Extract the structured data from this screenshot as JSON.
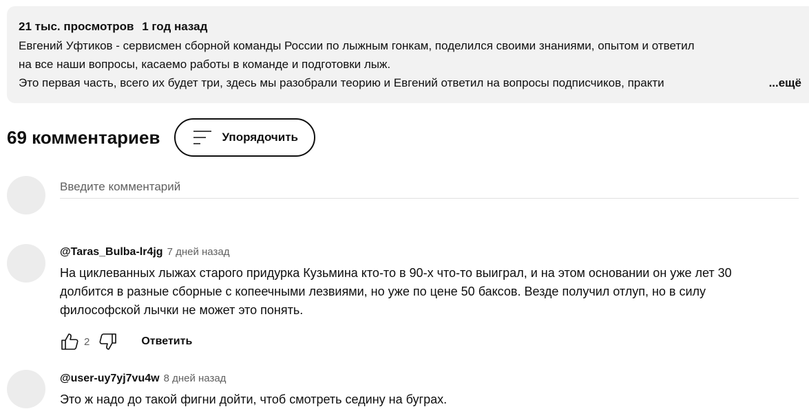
{
  "description": {
    "views": "21 тыс. просмотров",
    "date": "1 год назад",
    "line1": "Евгений Уфтиков - сервисмен сборной команды России по лыжным гонкам, поделился своими знаниями, опытом и ответил",
    "line2": "на все наши вопросы,  касаемо работы в команде и подготовки лыж.",
    "line3": "Это первая часть, всего их будет три, здесь мы разобрали теорию и Евгений ответил на вопросы подписчиков, практи",
    "more_label": "...ещё"
  },
  "comments_header": {
    "count_label": "69 комментариев",
    "sort_label": "Упорядочить",
    "sort_icon": "sort-icon"
  },
  "new_comment": {
    "placeholder": "Введите комментарий"
  },
  "comments": [
    {
      "author": "@Taras_Bulba-lr4jg",
      "time": "7 дней назад",
      "lines": [
        "На циклеванных лыжах старого придурка Кузьмина кто-то в 90-х что-то выиграл, и на этом основании он уже лет 30",
        "долбится в разные сборные с копеечными лезвиями, но уже по цене 50 баксов. Везде получил отлуп, но в силу",
        "философской лычки не может это понять."
      ],
      "likes": "2",
      "reply_label": "Ответить",
      "like_icon": "thumbs-up-icon",
      "dislike_icon": "thumbs-down-icon"
    },
    {
      "author": "@user-uy7yj7vu4w",
      "time": "8 дней назад",
      "lines": [
        "Это ж надо до такой фигни дойти, чтоб смотреть седину на буграх."
      ]
    }
  ]
}
